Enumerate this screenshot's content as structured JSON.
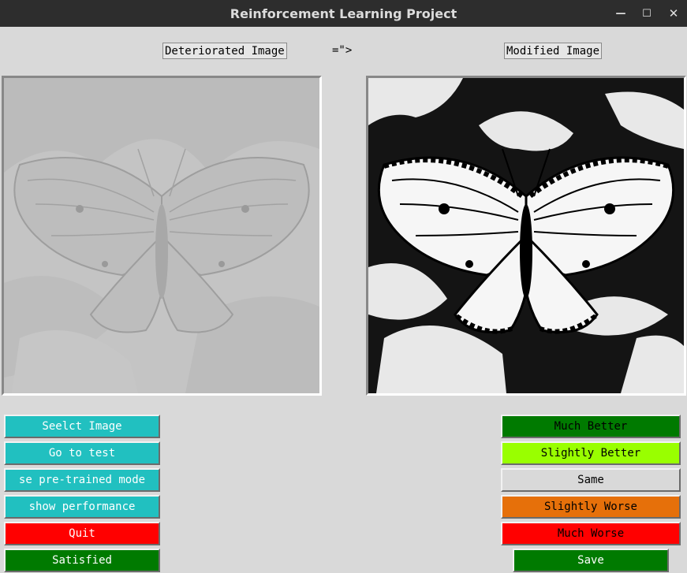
{
  "window": {
    "title": "Reinforcement Learning Project",
    "minimize_glyph": "—",
    "maximize_glyph": "☐",
    "close_glyph": "✕"
  },
  "header": {
    "left_label": "Deteriorated Image",
    "arrow": "=\">",
    "right_label": "Modified Image"
  },
  "left_buttons": [
    {
      "label": "Seelct Image",
      "bg": "#21c0c0",
      "fg": "#ffffff"
    },
    {
      "label": "Go to test",
      "bg": "#21c0c0",
      "fg": "#ffffff"
    },
    {
      "label": "se pre-trained mode",
      "bg": "#21c0c0",
      "fg": "#ffffff"
    },
    {
      "label": "show performance",
      "bg": "#21c0c0",
      "fg": "#ffffff"
    },
    {
      "label": "Quit",
      "bg": "#ff0000",
      "fg": "#ffffff"
    },
    {
      "label": "Satisfied",
      "bg": "#007a00",
      "fg": "#ffffff"
    }
  ],
  "right_buttons": [
    {
      "label": "Much Better",
      "bg": "#007a00",
      "fg": "#000000"
    },
    {
      "label": "Slightly Better",
      "bg": "#99ff00",
      "fg": "#000000"
    },
    {
      "label": "Same",
      "bg": "#d9d9d9",
      "fg": "#000000"
    },
    {
      "label": "Slightly Worse",
      "bg": "#e6700a",
      "fg": "#000000"
    },
    {
      "label": "Much Worse",
      "bg": "#ff0000",
      "fg": "#000000"
    },
    {
      "label": "Save",
      "bg": "#007a00",
      "fg": "#ffffff"
    }
  ],
  "images": {
    "deteriorated_tone": "#b8b8b8",
    "modified_tone": "#ffffff"
  }
}
